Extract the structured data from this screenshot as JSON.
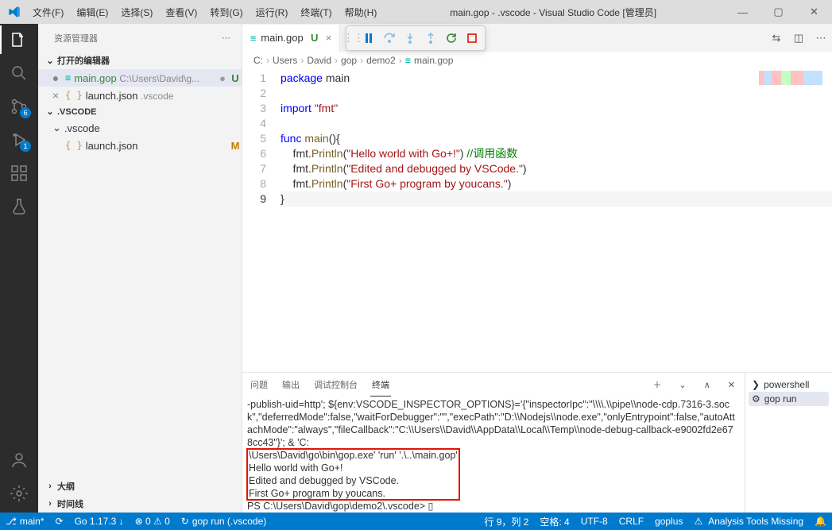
{
  "title": "main.gop - .vscode - Visual Studio Code [管理员]",
  "menu": [
    "文件(F)",
    "编辑(E)",
    "选择(S)",
    "查看(V)",
    "转到(G)",
    "运行(R)",
    "终端(T)",
    "帮助(H)"
  ],
  "sidebar": {
    "title": "资源管理器",
    "open_editors": "打开的编辑器",
    "files": [
      {
        "name": "main.gop",
        "path": "C:\\Users\\David\\g...",
        "mod": "U",
        "dirty": true,
        "type": "gop"
      },
      {
        "name": "launch.json",
        "path": ".vscode",
        "mod": "",
        "dirty": false,
        "type": "json"
      }
    ],
    "workspace": ".VSCODE",
    "folder": ".vscode",
    "wsfiles": [
      {
        "name": "launch.json",
        "mod": "M",
        "type": "json"
      }
    ],
    "outline": "大纲",
    "timeline": "时间线"
  },
  "activity_badges": {
    "scm": "6",
    "debug": "1"
  },
  "tab": {
    "name": "main.gop",
    "mod": "U"
  },
  "breadcrumb": [
    "C:",
    "Users",
    "David",
    "gop",
    "demo2",
    "main.gop"
  ],
  "code": {
    "lines": [
      {
        "n": 1,
        "html": "<span class='k'>package</span> main"
      },
      {
        "n": 2,
        "html": ""
      },
      {
        "n": 3,
        "html": "<span class='k'>import</span> <span class='s'>\"fmt\"</span>"
      },
      {
        "n": 4,
        "html": ""
      },
      {
        "n": 5,
        "html": "<span class='k'>func</span> <span class='f'>main</span>(){"
      },
      {
        "n": 6,
        "html": "    fmt.<span class='f'>Println</span>(<span class='s'>\"Hello world with Go+!\"</span>) <span class='c'>//调用函数</span>"
      },
      {
        "n": 7,
        "html": "    fmt.<span class='f'>Println</span>(<span class='s'>\"Edited and debugged by VSCode.\"</span>)"
      },
      {
        "n": 8,
        "html": "    fmt.<span class='f'>Println</span>(<span class='s'>\"First Go+ program by youcans.\"</span>)"
      },
      {
        "n": 9,
        "html": "}",
        "cur": true
      }
    ]
  },
  "panel": {
    "tabs": [
      "问题",
      "输出",
      "调试控制台",
      "终端"
    ],
    "active": 3,
    "side": [
      {
        "icon": "❯",
        "label": "powershell",
        "active": false
      },
      {
        "icon": "⚙",
        "label": "gop run",
        "active": true
      }
    ],
    "pre": "-publish-uid=http'; ${env:VSCODE_INSPECTOR_OPTIONS}='{\"inspectorIpc\":\"\\\\\\\\.\\\\pipe\\\\node-cdp.7316-3.sock\",\"deferredMode\":false,\"waitForDebugger\":\"\",\"execPath\":\"D:\\\\Nodejs\\\\node.exe\",\"onlyEntrypoint\":false,\"autoAttachMode\":\"always\",\"fileCallback\":\"C:\\\\Users\\\\David\\\\AppData\\\\Local\\\\Temp\\\\node-debug-callback-e9002fd2e678cc43\"}'; & 'C:",
    "hl": "\\Users\\David\\go\\bin\\gop.exe' 'run' '.\\..\\main.gop'\nHello world with Go+!\nEdited and debugged by VSCode.\nFirst Go+ program by youcans.",
    "post": "PS C:\\Users\\David\\gop\\demo2\\.vscode> ▯"
  },
  "status": {
    "branch": "main*",
    "go": "Go 1.17.3 ↓",
    "errs": "⊗ 0 ⚠ 0",
    "task": "gop run (.vscode)",
    "pos": "行 9，列 2",
    "spaces": "空格: 4",
    "enc": "UTF-8",
    "eol": "CRLF",
    "lang": "goplus",
    "warn": "Analysis Tools Missing",
    "bell": "🔔"
  }
}
